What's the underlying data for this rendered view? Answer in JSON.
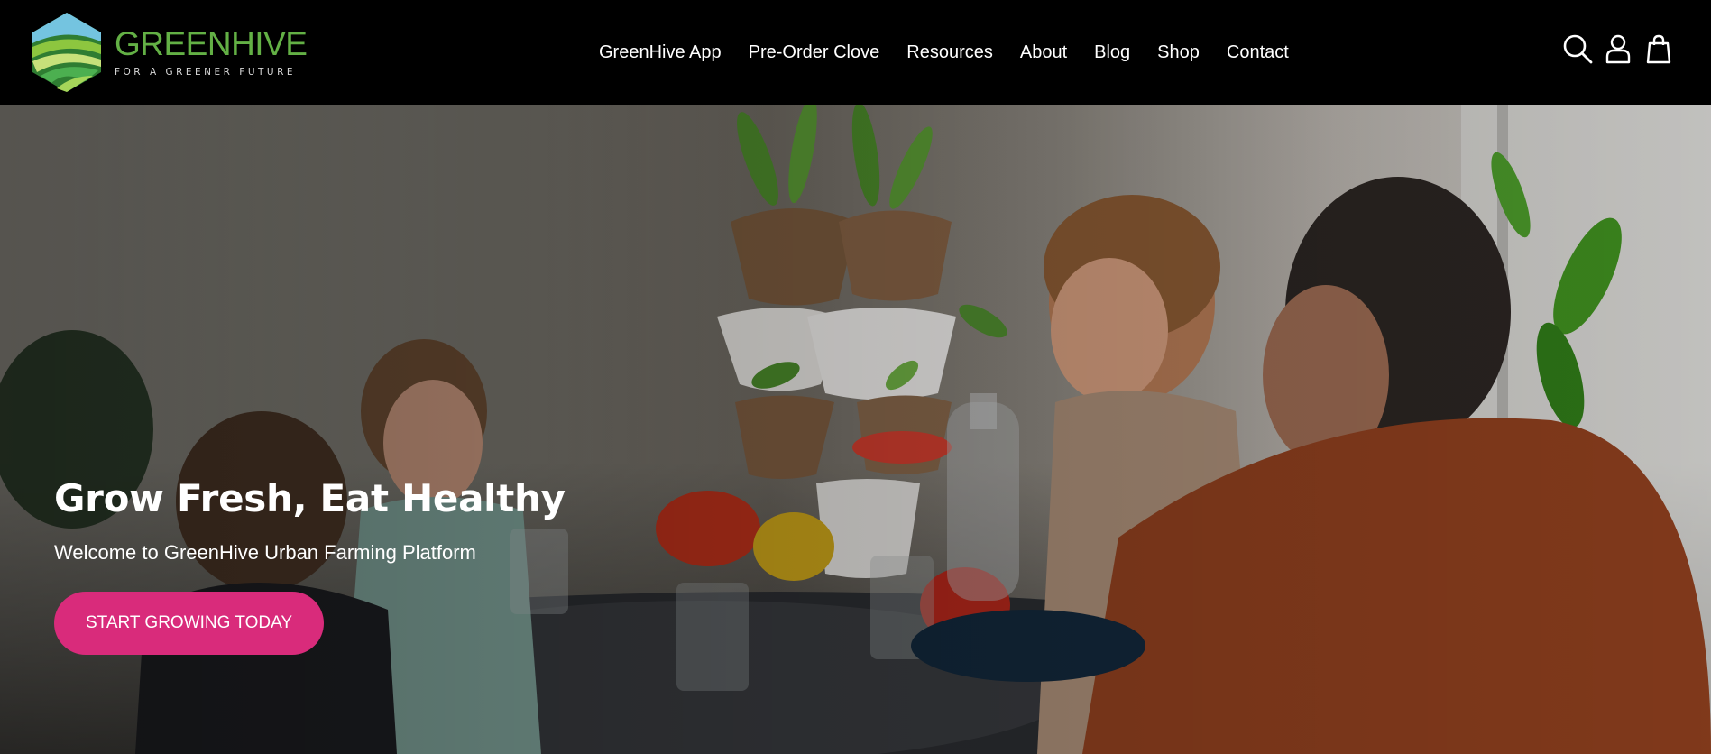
{
  "brand": {
    "name": "GREENHIVE",
    "tagline": "FOR A GREENER FUTURE",
    "logo_icon": "hexagon-field-logo",
    "color": "#63b045"
  },
  "nav": {
    "items": [
      {
        "label": "GreenHive App"
      },
      {
        "label": "Pre-Order Clove"
      },
      {
        "label": "Resources"
      },
      {
        "label": "About"
      },
      {
        "label": "Blog"
      },
      {
        "label": "Shop"
      },
      {
        "label": "Contact"
      }
    ]
  },
  "header_icons": {
    "search": "search-icon",
    "account": "user-icon",
    "cart": "shopping-bag-icon"
  },
  "hero": {
    "title": "Grow Fresh, Eat Healthy",
    "subtitle": "Welcome to GreenHive Urban Farming Platform",
    "cta_label": "START GROWING TODAY",
    "cta_color": "#d92b7b"
  }
}
